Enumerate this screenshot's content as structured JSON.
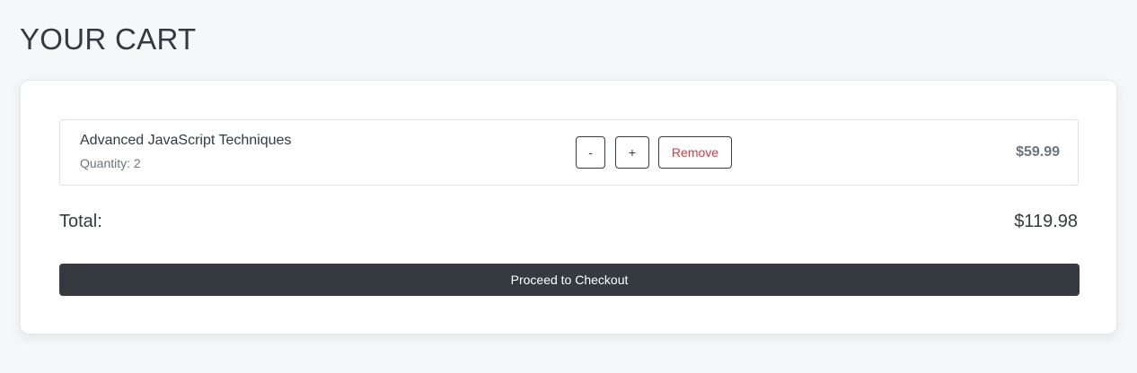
{
  "page": {
    "title": "YOUR CART"
  },
  "cart": {
    "items": [
      {
        "name": "Advanced JavaScript Techniques",
        "quantity_label": "Quantity: 2",
        "decrease_label": "-",
        "increase_label": "+",
        "remove_label": "Remove",
        "price": "$59.99"
      }
    ],
    "total_label": "Total:",
    "total_value": "$119.98",
    "checkout_label": "Proceed to Checkout"
  },
  "colors": {
    "background": "#f6f7f9",
    "card": "#ffffff",
    "primary_dark": "#343a40",
    "danger": "#dc3545",
    "muted": "#6c757d"
  }
}
